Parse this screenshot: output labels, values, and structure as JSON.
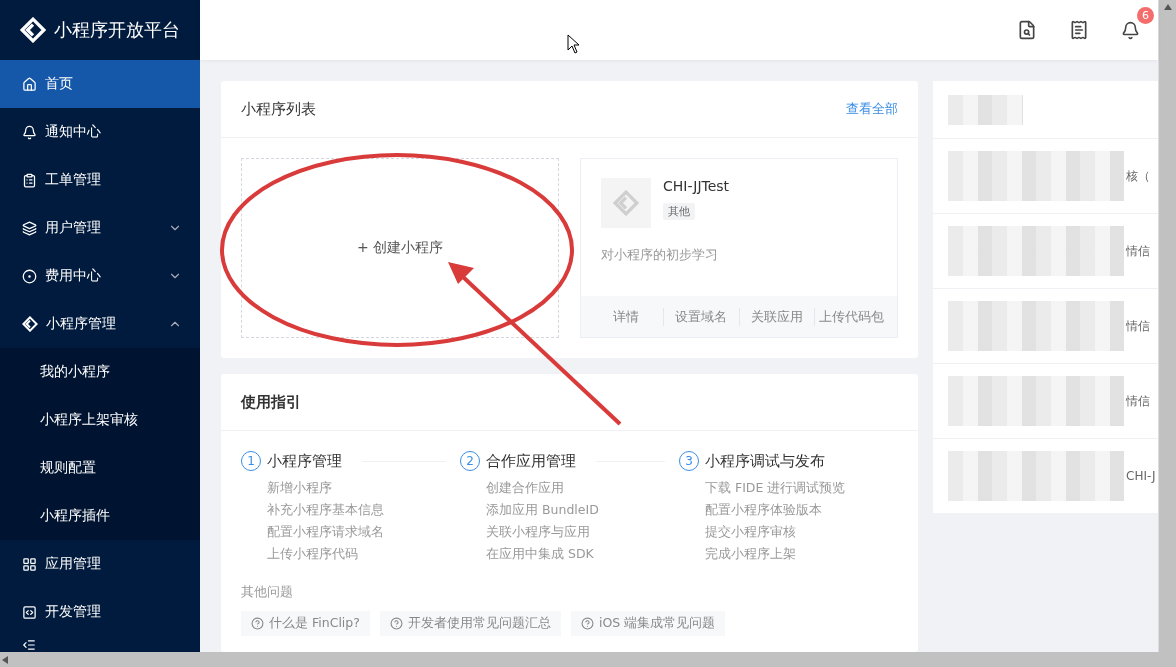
{
  "app": {
    "title": "小程序开放平台"
  },
  "sidebar": {
    "items": [
      {
        "kind": "link",
        "label": "首页",
        "selected": true
      },
      {
        "kind": "link",
        "label": "通知中心",
        "selected": false
      },
      {
        "kind": "link",
        "label": "工单管理",
        "selected": false
      },
      {
        "kind": "group",
        "label": "用户管理",
        "selected": false,
        "expanded": false
      },
      {
        "kind": "group",
        "label": "费用中心",
        "selected": false,
        "expanded": false
      },
      {
        "kind": "group",
        "label": "小程序管理",
        "selected": false,
        "expanded": true,
        "children": [
          {
            "label": "我的小程序",
            "selected": false
          },
          {
            "label": "小程序上架审核",
            "selected": false
          },
          {
            "label": "规则配置",
            "selected": false
          },
          {
            "label": "小程序插件",
            "selected": false
          }
        ]
      },
      {
        "kind": "link",
        "label": "应用管理",
        "selected": false
      },
      {
        "kind": "link",
        "label": "开发管理",
        "selected": false
      }
    ]
  },
  "topbar": {
    "notification_count": "6"
  },
  "program_list": {
    "title": "小程序列表",
    "view_all": "查看全部",
    "create_label": "+ 创建小程序",
    "apps": [
      {
        "name": "CHI-JJTest",
        "tag": "其他",
        "description": "对小程序的初步学习",
        "actions": [
          "详情",
          "设置域名",
          "关联应用",
          "上传代码包"
        ]
      }
    ]
  },
  "guide": {
    "title": "使用指引",
    "steps": [
      {
        "number": "1",
        "title": "小程序管理",
        "items": [
          "新增小程序",
          "补充小程序基本信息",
          "配置小程序请求域名",
          "上传小程序代码"
        ]
      },
      {
        "number": "2",
        "title": "合作应用管理",
        "items": [
          "创建合作应用",
          "添加应用 BundleID",
          "关联小程序与应用",
          "在应用中集成 SDK"
        ]
      },
      {
        "number": "3",
        "title": "小程序调试与发布",
        "items": [
          "下载 FIDE 进行调试预览",
          "配置小程序体验版本",
          "提交小程序审核",
          "完成小程序上架"
        ]
      }
    ],
    "other_title": "其他问题",
    "faq": [
      "什么是 FinClip?",
      "开发者使用常见问题汇总",
      "iOS 端集成常见问题"
    ]
  },
  "notices": {
    "rows": [
      {
        "text": "核（"
      },
      {
        "text": "情信"
      },
      {
        "text": "情信"
      },
      {
        "text": "情信"
      },
      {
        "text": "CHI-J"
      }
    ]
  }
}
